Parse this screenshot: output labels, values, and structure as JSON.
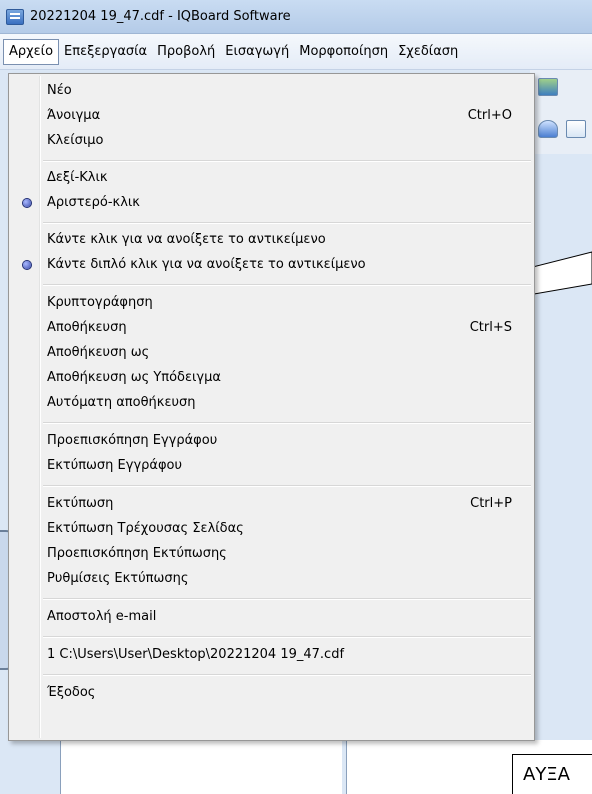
{
  "window": {
    "title": "20221204 19_47.cdf - IQBoard Software"
  },
  "menubar": {
    "items": [
      "Αρχείο",
      "Επεξεργασία",
      "Προβολή",
      "Εισαγωγή",
      "Μορφοποίηση",
      "Σχεδίαση"
    ]
  },
  "file_menu": {
    "new": "Νέο",
    "open": "Άνοιγμα",
    "open_shortcut": "Ctrl+O",
    "close": "Κλείσιμο",
    "right_click": "Δεξί-Κλικ",
    "left_click": "Αριστερό-κλικ",
    "click_open_object": "Κάντε κλικ για να ανοίξετε το αντικείμενο",
    "double_click_open_object": "Κάντε διπλό κλικ για να ανοίξετε το αντικείμενο",
    "encryption": "Κρυπτογράφηση",
    "save": "Αποθήκευση",
    "save_shortcut": "Ctrl+S",
    "save_as": "Αποθήκευση ως",
    "save_as_template": "Αποθήκευση ως Υπόδειγμα",
    "auto_save": "Αυτόματη αποθήκευση",
    "document_preview": "Προεπισκόπηση Εγγράφου",
    "print_document": "Εκτύπωση Εγγράφου",
    "print": "Εκτύπωση",
    "print_shortcut": "Ctrl+P",
    "print_current_page": "Εκτύπωση Τρέχουσας Σελίδας",
    "print_preview": "Προεπισκόπηση Εκτύπωσης",
    "print_settings": "Ρυθμίσεις Εκτύπωσης",
    "send_email": "Αποστολή e-mail",
    "recent_file_1": "1 C:\\Users\\User\\Desktop\\20221204 19_47.cdf",
    "exit": "Έξοδος"
  },
  "canvas": {
    "text_box": "ΑΥΞΑ"
  },
  "colors": {
    "radio_selected": "#3748a8",
    "menu_bg": "#f0f0f0",
    "app_bg": "#dbe7f5"
  }
}
